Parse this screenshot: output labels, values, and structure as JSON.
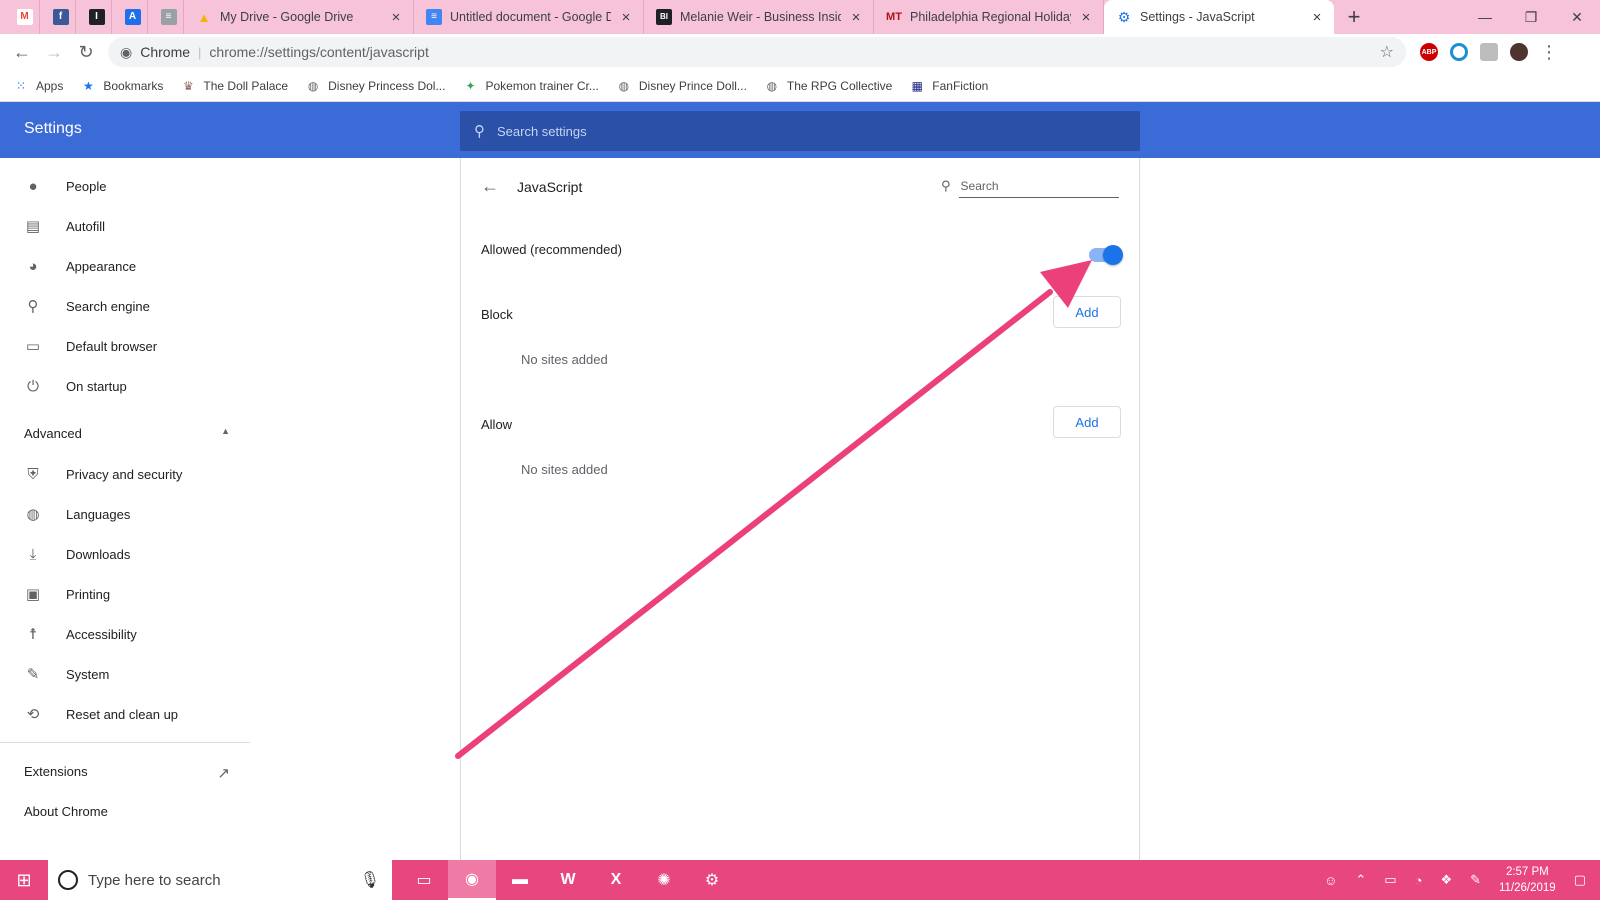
{
  "browser": {
    "pinned_tabs": [
      {
        "icon": "gmail-icon",
        "label": "M",
        "color": "#ea4335"
      },
      {
        "icon": "facebook-icon",
        "label": "f",
        "color": "#3b5998"
      },
      {
        "icon": "instapaper-icon",
        "label": "I",
        "color": "#202124"
      },
      {
        "icon": "tab-app-icon",
        "label": "A",
        "color": "#1f6feb"
      },
      {
        "icon": "tab-generic-icon",
        "label": "≡",
        "color": "#9aa0a6"
      }
    ],
    "tabs": [
      {
        "title": "My Drive - Google Drive",
        "icon": "google-drive-icon",
        "icon_glyph": "▲",
        "icon_color": "#f4b400",
        "close": "×"
      },
      {
        "title": "Untitled document - Google Do",
        "icon": "google-docs-icon",
        "icon_glyph": "≡",
        "icon_color": "#4285f4",
        "close": "×"
      },
      {
        "title": "Melanie Weir - Business Insider",
        "icon": "business-insider-icon",
        "icon_glyph": "BI",
        "icon_color": "#202124",
        "close": "×"
      },
      {
        "title": "Philadelphia Regional Holiday E",
        "icon": "mt-icon",
        "icon_glyph": "MT",
        "icon_color": "#b3121b",
        "close": "×"
      },
      {
        "title": "Settings - JavaScript",
        "icon": "settings-gear-icon",
        "icon_glyph": "⚙",
        "icon_color": "#1a73e8",
        "close": "×",
        "active": true
      }
    ],
    "new_tab": "+",
    "window_controls": {
      "minimize": "—",
      "restore": "❐",
      "close": "✕"
    },
    "omnibox": {
      "site": "Chrome",
      "separator": "|",
      "url": "chrome://settings/content/javascript"
    },
    "bookmarks": [
      {
        "label": "Apps",
        "icon": "apps-grid-icon",
        "glyph": "⋮⋮",
        "color": "#1a73e8"
      },
      {
        "label": "Bookmarks",
        "icon": "star-icon",
        "glyph": "★",
        "color": "#1a73e8"
      },
      {
        "label": "The Doll Palace",
        "icon": "doll-palace-icon",
        "glyph": "♛",
        "color": "#8d6e63"
      },
      {
        "label": "Disney Princess Dol...",
        "icon": "globe-icon",
        "glyph": "🌐",
        "color": "#5f6368"
      },
      {
        "label": "Pokemon trainer Cr...",
        "icon": "pokemon-icon",
        "glyph": "✦",
        "color": "#34a853"
      },
      {
        "label": "Disney Prince Doll...",
        "icon": "globe-icon",
        "glyph": "🌐",
        "color": "#5f6368"
      },
      {
        "label": "The RPG Collective",
        "icon": "globe-icon",
        "glyph": "🌐",
        "color": "#5f6368"
      },
      {
        "label": "FanFiction",
        "icon": "fanfiction-icon",
        "glyph": "▦",
        "color": "#1a237e"
      }
    ]
  },
  "settings": {
    "title": "Settings",
    "search_placeholder": "Search settings",
    "nav": [
      {
        "label": "People",
        "icon": "person-icon",
        "glyph": "👤"
      },
      {
        "label": "Autofill",
        "icon": "clipboard-icon",
        "glyph": "📋"
      },
      {
        "label": "Appearance",
        "icon": "palette-icon",
        "glyph": "🎨"
      },
      {
        "label": "Search engine",
        "icon": "search-icon",
        "glyph": "🔍"
      },
      {
        "label": "Default browser",
        "icon": "browser-window-icon",
        "glyph": "▭"
      },
      {
        "label": "On startup",
        "icon": "power-icon",
        "glyph": "⏻"
      }
    ],
    "advanced": {
      "label": "Advanced",
      "chevron": "▲"
    },
    "advanced_nav": [
      {
        "label": "Privacy and security",
        "icon": "shield-icon",
        "glyph": "🛡"
      },
      {
        "label": "Languages",
        "icon": "globe-icon",
        "glyph": "🌐"
      },
      {
        "label": "Downloads",
        "icon": "download-icon",
        "glyph": "⤓"
      },
      {
        "label": "Printing",
        "icon": "printer-icon",
        "glyph": "🖨"
      },
      {
        "label": "Accessibility",
        "icon": "accessibility-icon",
        "glyph": "♿"
      },
      {
        "label": "System",
        "icon": "wrench-icon",
        "glyph": "🔧"
      },
      {
        "label": "Reset and clean up",
        "icon": "history-icon",
        "glyph": "⟲"
      }
    ],
    "extensions": {
      "label": "Extensions",
      "icon": "open-external-icon",
      "glyph": "↗"
    },
    "about": "About Chrome"
  },
  "page": {
    "back_glyph": "←",
    "heading": "JavaScript",
    "search_placeholder": "Search",
    "allowed_label": "Allowed (recommended)",
    "allowed_enabled": true,
    "block_label": "Block",
    "block_add": "Add",
    "block_empty": "No sites added",
    "allow_label": "Allow",
    "allow_add": "Add",
    "allow_empty": "No sites added"
  },
  "annotation": {
    "color": "#ec407a"
  },
  "taskbar": {
    "search_placeholder": "Type here to search",
    "apps": [
      {
        "name": "task-view-icon",
        "glyph": "▭"
      },
      {
        "name": "chrome-icon",
        "glyph": "◉",
        "active": true
      },
      {
        "name": "file-explorer-icon",
        "glyph": "📁"
      },
      {
        "name": "word-icon",
        "glyph": "W"
      },
      {
        "name": "excel-icon",
        "glyph": "X"
      },
      {
        "name": "paint-icon",
        "glyph": "🎨"
      },
      {
        "name": "settings-icon",
        "glyph": "⚙"
      }
    ],
    "time": "2:57 PM",
    "date": "11/26/2019"
  }
}
